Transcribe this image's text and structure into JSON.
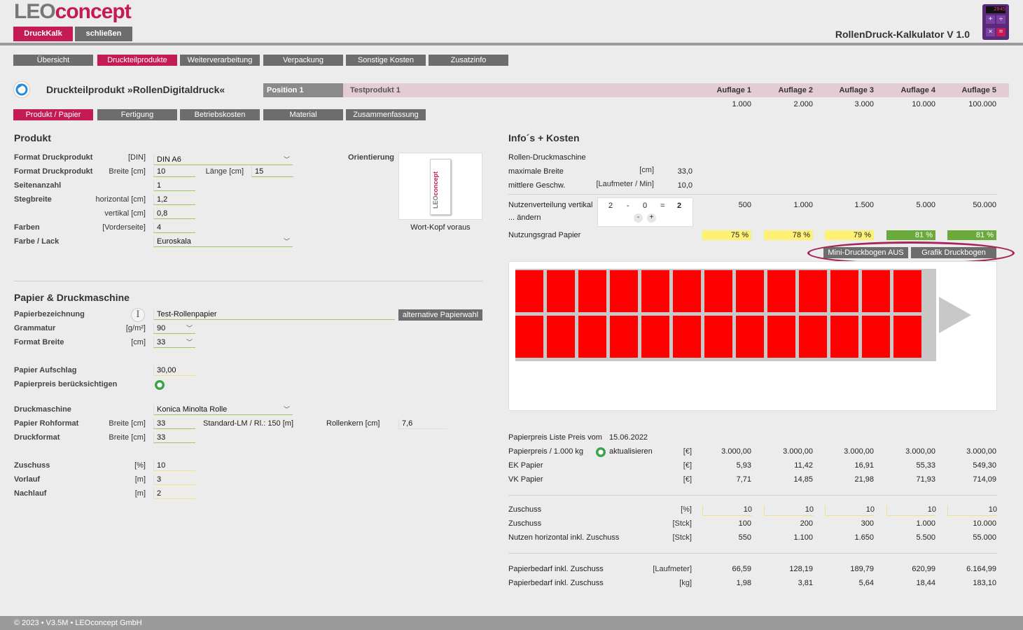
{
  "header": {
    "logo_leo": "LEO",
    "logo_concept": "concept",
    "btn_druckkalk": "DruckKalk",
    "btn_schliessen": "schließen",
    "app_title": "RollenDruck-Kalkulator V 1.0",
    "calc_display": "2045"
  },
  "main_tabs": [
    {
      "label": "Übersicht",
      "active": false
    },
    {
      "label": "Druckteilprodukte",
      "active": true
    },
    {
      "label": "Weiterverarbeitung",
      "active": false
    },
    {
      "label": "Verpackung",
      "active": false
    },
    {
      "label": "Sonstige Kosten",
      "active": false
    },
    {
      "label": "Zusatzinfo",
      "active": false
    }
  ],
  "product": {
    "title": "Druckteilprodukt »RollenDigitaldruck«",
    "position": "Position 1",
    "testprodukt": "Testprodukt 1"
  },
  "auflagen": {
    "headers": [
      "Auflage 1",
      "Auflage 2",
      "Auflage 3",
      "Auflage 4",
      "Auflage 5"
    ],
    "values": [
      "1.000",
      "2.000",
      "3.000",
      "10.000",
      "100.000"
    ]
  },
  "sub_tabs": [
    {
      "label": "Produkt / Papier",
      "active": true
    },
    {
      "label": "Fertigung",
      "active": false
    },
    {
      "label": "Betriebskosten",
      "active": false
    },
    {
      "label": "Material",
      "active": false
    },
    {
      "label": "Zusammenfassung",
      "active": false
    }
  ],
  "produkt_section": {
    "title": "Produkt",
    "format_label": "Format Druckprodukt",
    "format_unit": "[DIN]",
    "format_value": "DIN A6",
    "format2_label": "Format Druckprodukt",
    "breite_unit": "Breite [cm]",
    "breite_value": "10",
    "laenge_unit": "Länge [cm]",
    "laenge_value": "15",
    "seiten_label": "Seitenanzahl",
    "seiten_value": "1",
    "steg_label": "Stegbreite",
    "steg_h_unit": "horizontal [cm]",
    "steg_h_value": "1,2",
    "steg_v_unit": "vertikal [cm]",
    "steg_v_value": "0,8",
    "farben_label": "Farben",
    "farben_unit": "[Vorderseite]",
    "farben_value": "4",
    "lack_label": "Farbe / Lack",
    "lack_value": "Euroskala",
    "orient_label": "Orientierung",
    "orient_caption": "Wort-Kopf voraus"
  },
  "papier_section": {
    "title": "Papier & Druckmaschine",
    "bez_label": "Papierbezeichnung",
    "bez_value": "Test-Rollenpapier",
    "alt_button": "alternative Papierwahl",
    "gram_label": "Grammatur",
    "gram_unit": "[g/m²]",
    "gram_value": "90",
    "fb_label": "Format Breite",
    "fb_unit": "[cm]",
    "fb_value": "33",
    "aufschlag_label": "Papier Aufschlag",
    "aufschlag_value": "30,00",
    "preis_label": "Papierpreis berücksichtigen",
    "dm_label": "Druckmaschine",
    "dm_value": "Konica Minolta Rolle",
    "roh_label": "Papier Rohformat",
    "roh_unit": "Breite [cm]",
    "roh_value": "33",
    "standard_lm": "Standard-LM / Rl.: 150 [m]",
    "kern_label": "Rollenkern [cm]",
    "kern_value": "7,6",
    "df_label": "Druckformat",
    "df_unit": "Breite [cm]",
    "df_value": "33",
    "zuschuss_label": "Zuschuss",
    "zuschuss_unit": "[%]",
    "zuschuss_value": "10",
    "vorlauf_label": "Vorlauf",
    "vorlauf_unit": "[m]",
    "vorlauf_value": "3",
    "nachlauf_label": "Nachlauf",
    "nachlauf_unit": "[m]",
    "nachlauf_value": "2"
  },
  "info": {
    "title": "Info´s + Kosten",
    "maschine": "Rollen-Druckmaschine",
    "max_breite_label": "maximale Breite",
    "max_breite_unit": "[cm]",
    "max_breite_value": "33,0",
    "geschw_label": "mittlere Geschw.",
    "geschw_unit": "[Laufmeter / Min]",
    "geschw_value": "10,0",
    "nutzen_label": "Nutzenverteilung vertikal",
    "aendern_label": "... ändern",
    "nv_a": "2",
    "nv_minus": "-",
    "nv_b": "0",
    "nv_eq": "=",
    "nv_res": "2",
    "btn_minus": "-",
    "btn_plus": "+",
    "nutzen_values": [
      "500",
      "1.000",
      "1.500",
      "5.000",
      "50.000"
    ],
    "grad_label": "Nutzungsgrad Papier",
    "grad_values": [
      "75 %",
      "78 %",
      "79 %",
      "81 %",
      "81 %"
    ],
    "btn_mini": "Mini-Druckbogen AUS",
    "btn_grafik": "Grafik Druckbogen"
  },
  "kosten": {
    "liste_label": "Papierpreis Liste Preis vom",
    "liste_date": "15.06.2022",
    "pp_label": "Papierpreis / 1.000 kg",
    "aktualisieren": "aktualisieren",
    "eur": "[€]",
    "pp_values": [
      "3.000,00",
      "3.000,00",
      "3.000,00",
      "3.000,00",
      "3.000,00"
    ],
    "ek_label": "EK Papier",
    "ek_values": [
      "5,93",
      "11,42",
      "16,91",
      "55,33",
      "549,30"
    ],
    "vk_label": "VK Papier",
    "vk_values": [
      "7,71",
      "14,85",
      "21,98",
      "71,93",
      "714,09"
    ],
    "z1_label": "Zuschuss",
    "z1_unit": "[%]",
    "z1_values": [
      "10",
      "10",
      "10",
      "10",
      "10"
    ],
    "z2_label": "Zuschuss",
    "z2_unit": "[Stck]",
    "z2_values": [
      "100",
      "200",
      "300",
      "1.000",
      "10.000"
    ],
    "nh_label": "Nutzen horizontal inkl. Zuschuss",
    "nh_unit": "[Stck]",
    "nh_values": [
      "550",
      "1.100",
      "1.650",
      "5.500",
      "55.000"
    ],
    "pb1_label": "Papierbedarf inkl. Zuschuss",
    "pb1_unit": "[Laufmeter]",
    "pb1_values": [
      "66,59",
      "128,19",
      "189,79",
      "620,99",
      "6.164,99"
    ],
    "pb2_label": "Papierbedarf inkl. Zuschuss",
    "pb2_unit": "[kg]",
    "pb2_values": [
      "1,98",
      "3,81",
      "5,64",
      "18,44",
      "183,10"
    ]
  },
  "footer": "© 2023 • V3.5M • LEOconcept GmbH",
  "colors": {
    "accent": "#c41a56",
    "tab": "#6d6d6d",
    "sheet": "#ff0000",
    "ok": "#6aaa3a",
    "warn": "#fff176"
  }
}
